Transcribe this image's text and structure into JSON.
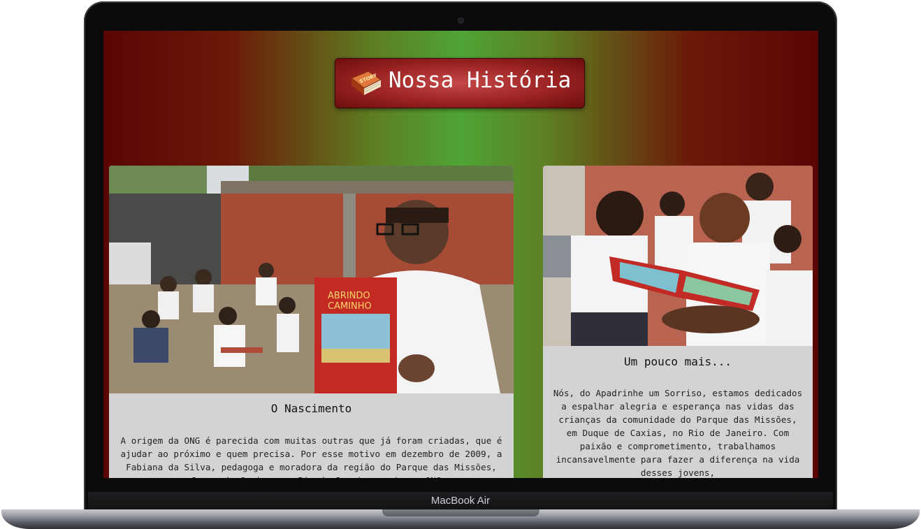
{
  "device": {
    "brand_label": "MacBook Air"
  },
  "hero": {
    "title": "Nossa História",
    "icon": "book-icon",
    "icon_label": "STORY"
  },
  "cards": [
    {
      "image": "photo-woman-holding-book-with-children",
      "title": "O Nascimento",
      "body": "A origem da ONG é parecida com muitas outras que já foram criadas, que é ajudar ao próximo e quem precisa. Por esse motivo em dezembro de 2009, a Fabiana da Silva, pedagoga e moradora da região do Parque das Missões, em Duque de Caxias, no Rio de Janeiro, criou a ONG."
    },
    {
      "image": "photo-girls-reading-book",
      "title": "Um pouco mais...",
      "body": "Nós, do Apadrinhe um Sorriso, estamos dedicados a espalhar alegria e esperança nas vidas das crianças da comunidade do Parque das Missões, em Duque de Caxias, no Rio de Janeiro. Com paixão e comprometimento, trabalhamos incansavelmente para fazer a diferença na vida desses jovens,"
    }
  ],
  "colors": {
    "gradient_edge": "#5a0505",
    "gradient_center": "#4ea434",
    "badge": "#9a2222",
    "card_bg": "#d3d3d3"
  }
}
